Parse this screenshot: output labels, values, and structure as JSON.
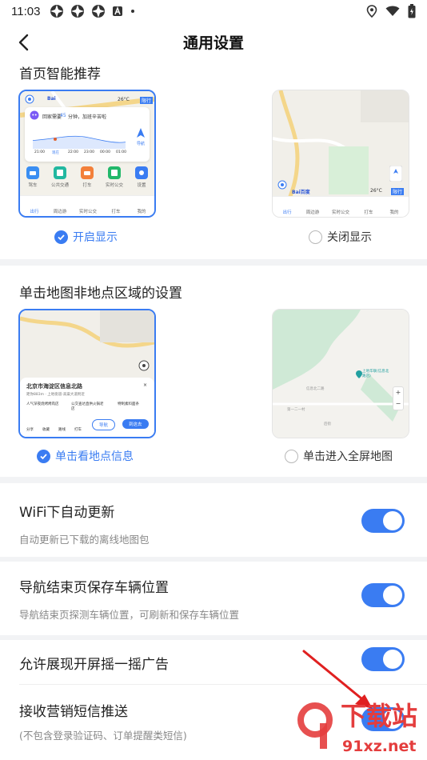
{
  "status_bar": {
    "time": "11:03",
    "icons": [
      "app-notification-icon",
      "app-notification-icon",
      "app-notification-icon",
      "a-badge-icon",
      "dot-icon",
      "location-icon",
      "wifi-icon",
      "battery-icon"
    ]
  },
  "header": {
    "title": "通用设置",
    "back_icon": "chevron-left-icon"
  },
  "home_recommend": {
    "title": "首页智能推荐",
    "option_on": "开启显示",
    "option_off": "关闭显示",
    "selected": "on",
    "preview_on": {
      "greeting_prefix": "回家需要",
      "greeting_minutes": "45",
      "greeting_suffix": "分钟，加班辛苦啦",
      "weather": "26°C",
      "badge": "限行",
      "nav_label": "导航",
      "times": [
        "21:00",
        "现在",
        "22:00",
        "23:00",
        "00:00",
        "01:00"
      ],
      "icons": [
        "驾车",
        "公共交通",
        "打车",
        "实时公交",
        "设置"
      ],
      "tabs": [
        "出行",
        "周边游",
        "实时公交",
        "打车",
        "我的"
      ]
    },
    "preview_off": {
      "weather": "26°C",
      "badge": "限行",
      "tabs": [
        "出行",
        "周边游",
        "实时公交",
        "打车",
        "我的"
      ],
      "brand": "Bai百度"
    }
  },
  "map_click": {
    "title": "单击地图非地点区域的设置",
    "option_info": "单击看地点信息",
    "option_full": "单击进入全屏地图",
    "selected": "info",
    "preview_info": {
      "place_name": "北京市海淀区信息北路",
      "place_sub": "距你883m · 上地街道-高粱大道附近",
      "tags": [
        "人气深夜烧烤烤肉店",
        "公交查达直供火锅老店",
        "特制素料面条"
      ],
      "actions": [
        "分享",
        "收藏",
        "路线",
        "打车"
      ],
      "btn_nav": "导航",
      "btn_go": "到这去"
    },
    "preview_full": {
      "poi": "上地华联(信息北路店)",
      "road1": "信息北二路",
      "road2": "第一二一村",
      "road3": "后街"
    }
  },
  "settings": [
    {
      "title": "WiFi下自动更新",
      "desc": "自动更新已下载的离线地图包",
      "enabled": "true"
    },
    {
      "title": "导航结束页保存车辆位置",
      "desc": "导航结束页探测车辆位置，可刷新和保存车辆位置",
      "enabled": "true"
    },
    {
      "title": "允许展现开屏摇一摇广告",
      "desc": "",
      "enabled": "true"
    },
    {
      "title": "接收营销短信推送",
      "desc": "(不包含登录验证码、订单提醒类短信)",
      "enabled": "true"
    }
  ],
  "watermark": {
    "text_cn": "下载站",
    "text_url": "91xz.net"
  },
  "colors": {
    "accent": "#3a7cf2",
    "annotation_arrow": "#e02020",
    "watermark": "#e43d3d"
  }
}
